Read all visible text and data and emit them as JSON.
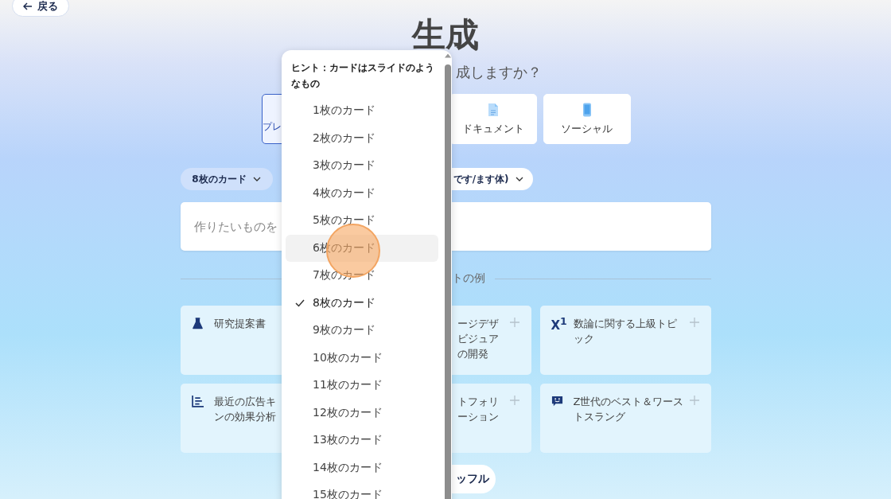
{
  "back_button": {
    "label": "戻る"
  },
  "title": "生成",
  "subtitle": "成しますか？",
  "types": [
    {
      "label": "プレ",
      "selected": true,
      "kind": "presentation"
    },
    {
      "label": "ドキュメント",
      "selected": false,
      "kind": "document"
    },
    {
      "label": "ソーシャル",
      "selected": false,
      "kind": "social"
    }
  ],
  "options": [
    {
      "label": "8枚のカード",
      "kind": "count"
    },
    {
      "label": "です/ます体)",
      "kind": "tone"
    }
  ],
  "prompt_field": {
    "placeholder": "作りたいものを"
  },
  "examples_heading": "トの例",
  "examples": [
    {
      "text": "研究提案書"
    },
    {
      "text": "ージデザビジュアの開発"
    },
    {
      "text": "数論に関する上級トピック",
      "icon_text": "X$^{1}$"
    },
    {
      "text": "最近の広告キンの効果分析"
    },
    {
      "text": "トフォリーション"
    },
    {
      "text": "Z世代のベスト＆ワーストスラング"
    }
  ],
  "shuffle_button": {
    "label": "ッフル"
  },
  "dropdown": {
    "hint": "ヒント：カードはスライドのようなもの",
    "items": [
      {
        "label": "1枚のカード",
        "selected": false,
        "hovered": false
      },
      {
        "label": "2枚のカード",
        "selected": false,
        "hovered": false
      },
      {
        "label": "3枚のカード",
        "selected": false,
        "hovered": false
      },
      {
        "label": "4枚のカード",
        "selected": false,
        "hovered": false
      },
      {
        "label": "5枚のカード",
        "selected": false,
        "hovered": false
      },
      {
        "label": "6枚のカード",
        "selected": false,
        "hovered": true
      },
      {
        "label": "7枚のカード",
        "selected": false,
        "hovered": false
      },
      {
        "label": "8枚のカード",
        "selected": true,
        "hovered": false
      },
      {
        "label": "9枚のカード",
        "selected": false,
        "hovered": false
      },
      {
        "label": "10枚のカード",
        "selected": false,
        "hovered": false
      },
      {
        "label": "11枚のカード",
        "selected": false,
        "hovered": false
      },
      {
        "label": "12枚のカード",
        "selected": false,
        "hovered": false
      },
      {
        "label": "13枚のカード",
        "selected": false,
        "hovered": false
      },
      {
        "label": "14枚のカード",
        "selected": false,
        "hovered": false
      },
      {
        "label": "15枚のカード",
        "selected": false,
        "hovered": false
      }
    ]
  }
}
